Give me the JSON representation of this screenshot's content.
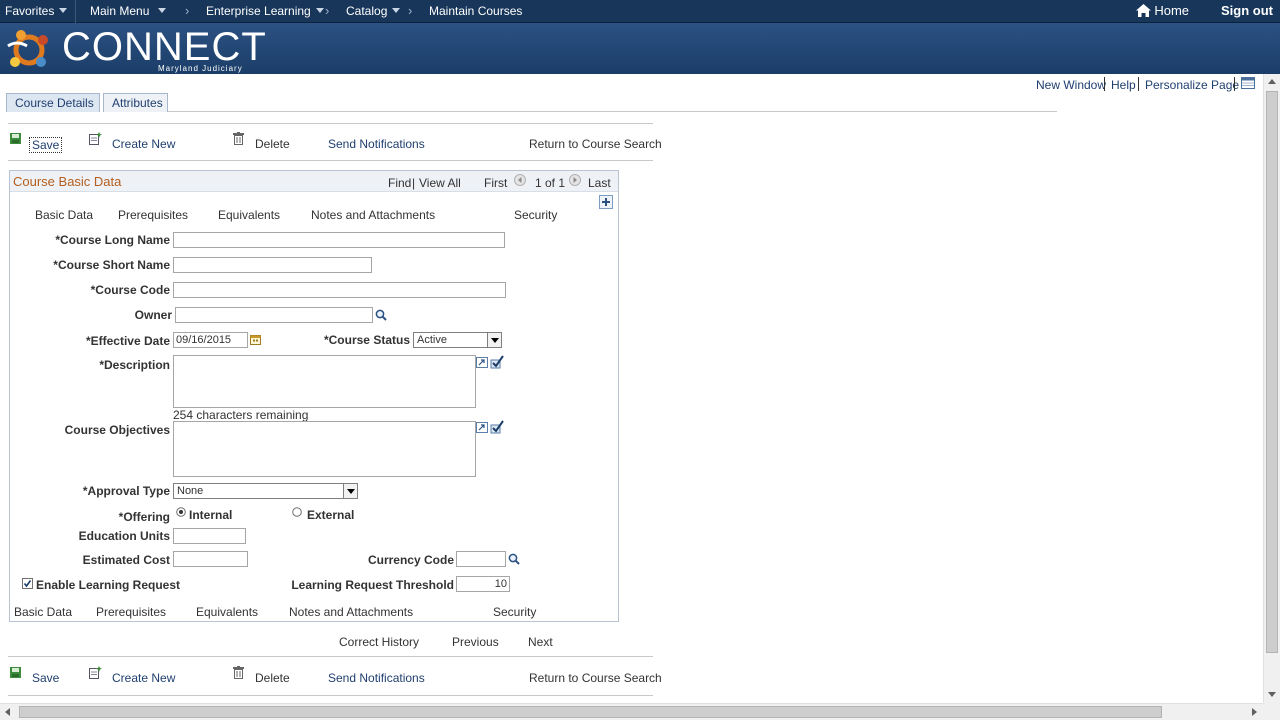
{
  "nav": {
    "favorites": "Favorites",
    "main_menu": "Main Menu",
    "enterprise_learning": "Enterprise Learning",
    "catalog": "Catalog",
    "maintain_courses": "Maintain Courses",
    "home": "Home",
    "sign_out": "Sign out"
  },
  "brand": {
    "name": "CONNECT",
    "subtitle": "Maryland Judiciary"
  },
  "page_links": {
    "new_window": "New Window",
    "help": "Help",
    "personalize": "Personalize Page"
  },
  "tabs": [
    {
      "label": "Course Details",
      "active": true
    },
    {
      "label": "Attributes",
      "active": false
    }
  ],
  "toolbar": {
    "save": "Save",
    "create_new": "Create New",
    "delete": "Delete",
    "send_notifications": "Send Notifications",
    "return": "Return to Course Search"
  },
  "group": {
    "title": "Course Basic Data",
    "find": "Find",
    "view_all": "View All",
    "first": "First",
    "count": "1 of 1",
    "last": "Last"
  },
  "subtabs": {
    "basic_data": "Basic Data",
    "prerequisites": "Prerequisites",
    "equivalents": "Equivalents",
    "notes": "Notes and Attachments",
    "security": "Security"
  },
  "form": {
    "course_long_name_label": "*Course Long Name",
    "course_long_name_value": "",
    "course_short_name_label": "*Course Short Name",
    "course_short_name_value": "",
    "course_code_label": "*Course Code",
    "course_code_value": "",
    "owner_label": "Owner",
    "owner_value": "",
    "effective_date_label": "*Effective Date",
    "effective_date_value": "09/16/2015",
    "course_status_label": "*Course Status",
    "course_status_value": "Active",
    "description_label": "*Description",
    "chars_remaining": "254 characters remaining",
    "objectives_label": "Course Objectives",
    "approval_type_label": "*Approval Type",
    "approval_type_value": "None",
    "offering_label": "*Offering",
    "offering_internal": "Internal",
    "offering_external": "External",
    "offering_selected": "Internal",
    "education_units_label": "Education Units",
    "education_units_value": "",
    "estimated_cost_label": "Estimated Cost",
    "estimated_cost_value": "",
    "currency_code_label": "Currency Code",
    "currency_code_value": "",
    "enable_learning_request_label": "Enable Learning Request",
    "enable_learning_request_checked": true,
    "threshold_label": "Learning Request Threshold",
    "threshold_value": "10"
  },
  "footer_nav": {
    "correct_history": "Correct History",
    "previous": "Previous",
    "next": "Next"
  },
  "colors": {
    "nav_bar": "#17365a",
    "brand_bar": "#234a79",
    "link": "#1f3f6f",
    "group_title": "#b45d1c"
  }
}
